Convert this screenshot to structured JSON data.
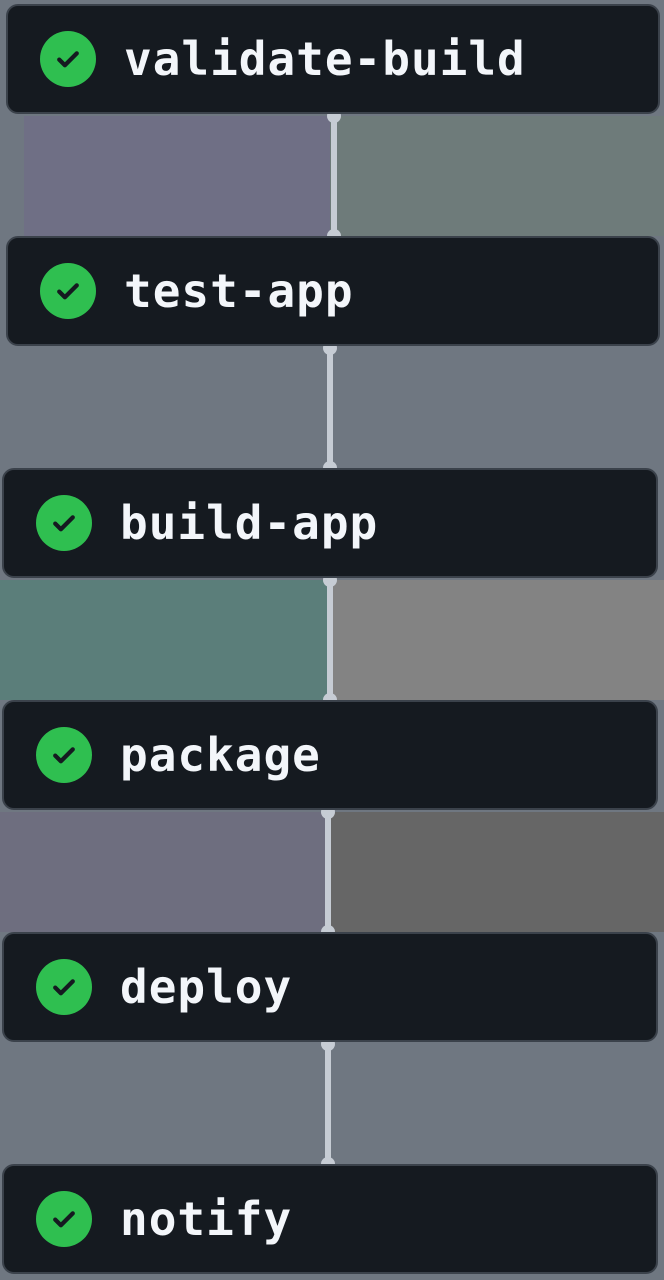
{
  "jobs": [
    {
      "name": "validate-build",
      "status": "success",
      "icon": "check-circle-icon"
    },
    {
      "name": "test-app",
      "status": "success",
      "icon": "check-circle-icon"
    },
    {
      "name": "build-app",
      "status": "success",
      "icon": "check-circle-icon"
    },
    {
      "name": "package",
      "status": "success",
      "icon": "check-circle-icon"
    },
    {
      "name": "deploy",
      "status": "success",
      "icon": "check-circle-icon"
    },
    {
      "name": "notify",
      "status": "success",
      "icon": "check-circle-icon"
    }
  ],
  "colors": {
    "card": "#151a20",
    "text": "#f3f6fa",
    "success": "#2fbf50",
    "connector": "#c6ccd4"
  }
}
